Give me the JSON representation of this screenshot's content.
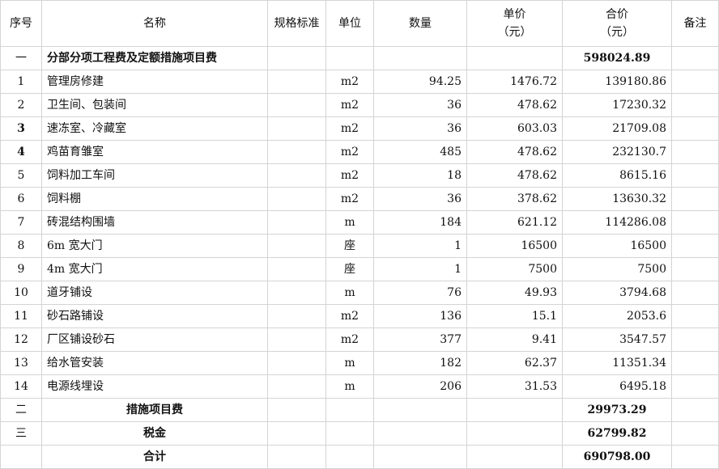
{
  "headers": {
    "seq": "序号",
    "name": "名称",
    "spec": "规格标准",
    "unit": "单位",
    "qty": "数量",
    "price_line1": "单价",
    "price_line2": "（元）",
    "total_line1": "合价",
    "total_line2": "（元）",
    "note": "备注"
  },
  "section1": {
    "seq": "一",
    "name": "分部分项工程费及定额措施项目费",
    "total": "598024.89"
  },
  "items": [
    {
      "seq": "1",
      "name": "管理房修建",
      "unit": "m2",
      "qty": "94.25",
      "price": "1476.72",
      "total": "139180.86"
    },
    {
      "seq": "2",
      "name": "卫生间、包装间",
      "unit": "m2",
      "qty": "36",
      "price": "478.62",
      "total": "17230.32"
    },
    {
      "seq": "3",
      "name": "速冻室、冷藏室",
      "unit": "m2",
      "qty": "36",
      "price": "603.03",
      "total": "21709.08"
    },
    {
      "seq": "4",
      "name": "鸡苗育雏室",
      "unit": "m2",
      "qty": "485",
      "price": "478.62",
      "total": "232130.7"
    },
    {
      "seq": "5",
      "name": "饲料加工车间",
      "unit": "m2",
      "qty": "18",
      "price": "478.62",
      "total": "8615.16"
    },
    {
      "seq": "6",
      "name": "饲料棚",
      "unit": "m2",
      "qty": "36",
      "price": "378.62",
      "total": "13630.32"
    },
    {
      "seq": "7",
      "name": "砖混结构围墙",
      "unit": "m",
      "qty": "184",
      "price": "621.12",
      "total": "114286.08"
    },
    {
      "seq": "8",
      "name": "6m 宽大门",
      "unit": "座",
      "qty": "1",
      "price": "16500",
      "total": "16500"
    },
    {
      "seq": "9",
      "name": "4m 宽大门",
      "unit": "座",
      "qty": "1",
      "price": "7500",
      "total": "7500"
    },
    {
      "seq": "10",
      "name": "道牙铺设",
      "unit": "m",
      "qty": "76",
      "price": "49.93",
      "total": "3794.68"
    },
    {
      "seq": "11",
      "name": "砂石路铺设",
      "unit": "m2",
      "qty": "136",
      "price": "15.1",
      "total": "2053.6"
    },
    {
      "seq": "12",
      "name": "厂区铺设砂石",
      "unit": "m2",
      "qty": "377",
      "price": "9.41",
      "total": "3547.57"
    },
    {
      "seq": "13",
      "name": "给水管安装",
      "unit": "m",
      "qty": "182",
      "price": "62.37",
      "total": "11351.34"
    },
    {
      "seq": "14",
      "name": "电源线埋设",
      "unit": "m",
      "qty": "206",
      "price": "31.53",
      "total": "6495.18"
    }
  ],
  "section2": {
    "seq": "二",
    "name": "措施项目费",
    "total": "29973.29"
  },
  "section3": {
    "seq": "三",
    "name": "税金",
    "total": "62799.82"
  },
  "grand_total": {
    "name": "合计",
    "total": "690798.00"
  }
}
